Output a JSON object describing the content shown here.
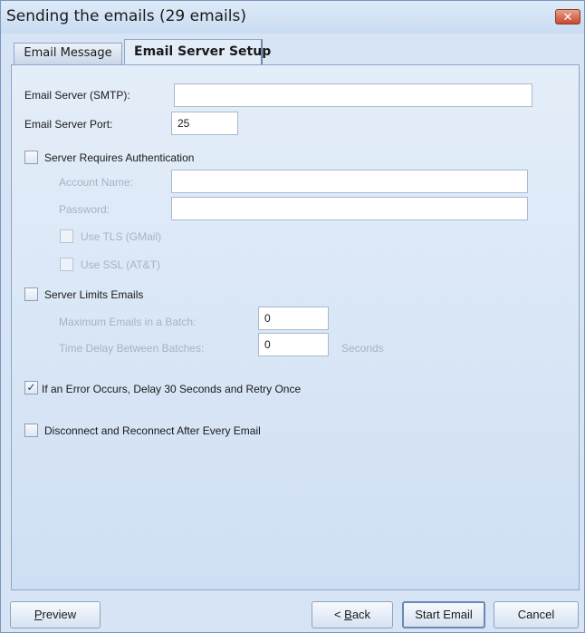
{
  "window": {
    "title": "Sending the emails (29 emails)",
    "close_glyph": "✕"
  },
  "tabs": [
    {
      "label": "Email Message",
      "active": false
    },
    {
      "label": "Email Server Setup",
      "active": true
    }
  ],
  "server": {
    "smtp_label": "Email Server (SMTP):",
    "smtp_value": "",
    "port_label": "Email Server Port:",
    "port_value": "25"
  },
  "auth": {
    "checkbox_label": "Server Requires Authentication",
    "checked": false,
    "account_label": "Account Name:",
    "account_value": "",
    "password_label": "Password:",
    "password_value": "",
    "tls_label": "Use TLS (GMail)",
    "tls_checked": false,
    "ssl_label": "Use SSL (AT&T)",
    "ssl_checked": false
  },
  "limits": {
    "checkbox_label": "Server Limits Emails",
    "checked": false,
    "max_label": "Maximum Emails in a Batch:",
    "max_value": "0",
    "delay_label": "Time Delay Between Batches:",
    "delay_value": "0",
    "delay_unit": "Seconds"
  },
  "options": {
    "retry_label": "If an Error Occurs, Delay 30 Seconds and Retry Once",
    "retry_checked": true,
    "retry_check_glyph": "✓",
    "reconnect_label": "Disconnect and Reconnect After Every Email",
    "reconnect_checked": false
  },
  "buttons": {
    "preview_label": "Preview",
    "preview_mnemonic": "P",
    "preview_rest": "review",
    "back_prefix": "< ",
    "back_mnemonic": "B",
    "back_rest": "ack",
    "start_label": "Start Email",
    "cancel_label": "Cancel"
  },
  "colors": {
    "background": "#d6e4f5",
    "panel": "#e4eef9",
    "close_button": "#c9492c",
    "disabled_text": "#a6b3c4"
  }
}
